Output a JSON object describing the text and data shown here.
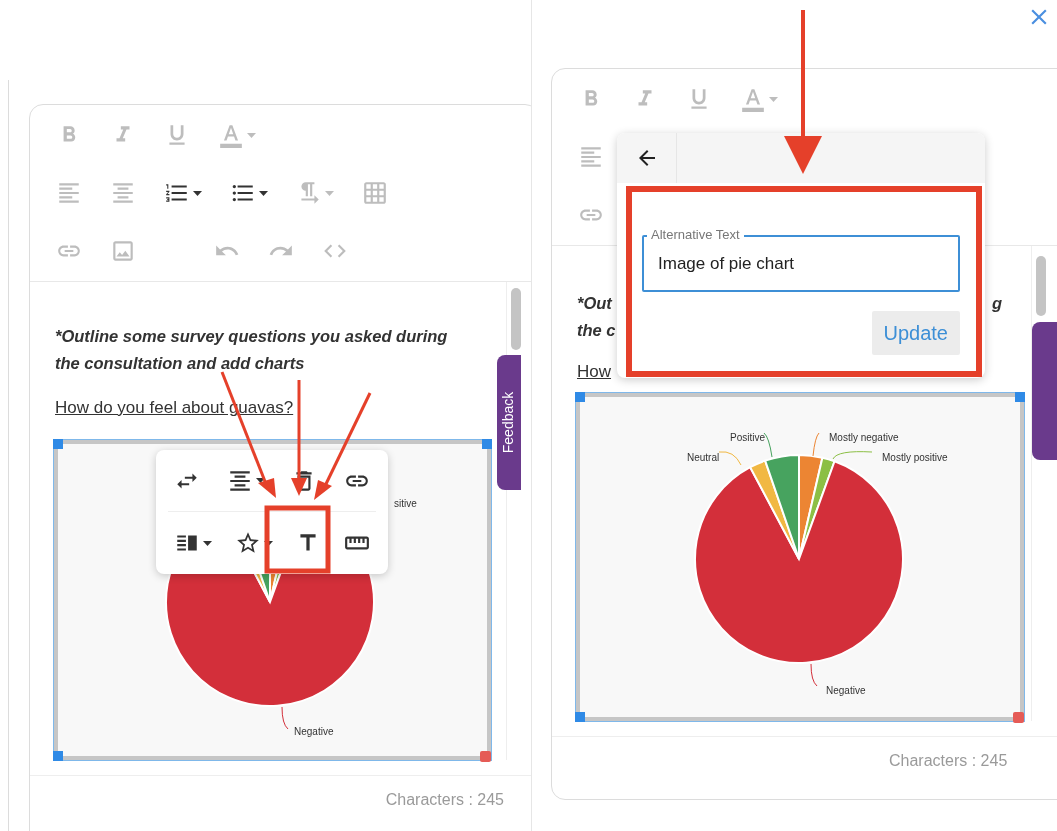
{
  "left_editor": {
    "toolbar_rows": [
      [
        {
          "kind": "bold",
          "disabled": true
        },
        {
          "kind": "italic",
          "disabled": true
        },
        {
          "kind": "underline",
          "disabled": true
        },
        {
          "kind": "font-color",
          "disabled": true
        }
      ],
      [
        {
          "kind": "align-left",
          "disabled": true
        },
        {
          "kind": "align-center",
          "disabled": true
        },
        {
          "kind": "numbered-list",
          "disabled": false
        },
        {
          "kind": "bulleted-list",
          "disabled": false
        },
        {
          "kind": "paragraph",
          "disabled": true
        },
        {
          "kind": "table",
          "disabled": true
        }
      ],
      [
        {
          "kind": "link",
          "disabled": true
        },
        {
          "kind": "image",
          "disabled": true
        },
        {
          "kind": "undo",
          "disabled": true
        },
        {
          "kind": "redo",
          "disabled": true
        },
        {
          "kind": "code",
          "disabled": true
        }
      ]
    ],
    "question": "*Outline some survey questions you asked during the consultation and add charts",
    "link": "How do you feel about guavas?",
    "chart_labels": [
      "sitive",
      "Negative"
    ],
    "image_toolbar": [
      [
        {
          "kind": "replace"
        },
        {
          "kind": "align"
        },
        {
          "kind": "remove"
        },
        {
          "kind": "link"
        }
      ],
      [
        {
          "kind": "wrap"
        },
        {
          "kind": "style"
        },
        {
          "kind": "alt-text"
        },
        {
          "kind": "size"
        }
      ]
    ],
    "feedback_tab": "Feedback",
    "character_count": "Characters : 245"
  },
  "right_editor": {
    "toolbar_rows": [
      [
        {
          "kind": "bold",
          "disabled": true
        },
        {
          "kind": "italic",
          "disabled": true
        },
        {
          "kind": "underline",
          "disabled": true
        },
        {
          "kind": "font-color",
          "disabled": true
        }
      ],
      [
        {
          "kind": "align-left",
          "disabled": true
        }
      ],
      [
        {
          "kind": "link",
          "disabled": true
        }
      ]
    ],
    "question_fragments": [
      "*Out",
      "g",
      "the c"
    ],
    "link": "How",
    "chart_labels": [
      "Positive",
      "Mostly negative",
      "Neutral",
      "Mostly positive",
      "Negative"
    ],
    "alt_text_popup": {
      "label": "Alternative Text",
      "value": "Image of pie chart",
      "button": "Update"
    },
    "character_count": "Characters : 245"
  }
}
